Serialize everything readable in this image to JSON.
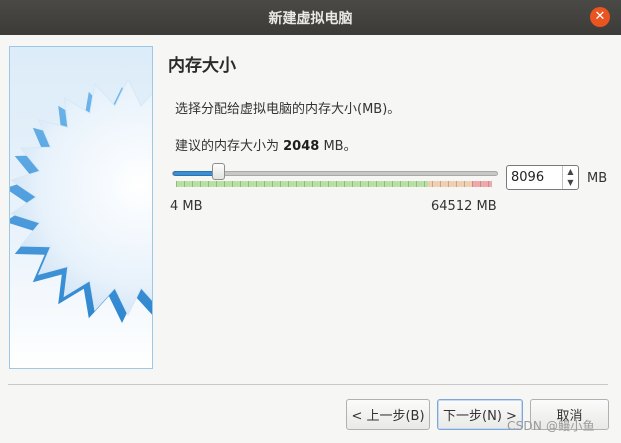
{
  "window": {
    "title": "新建虚拟电脑",
    "close_icon": "close-icon"
  },
  "page": {
    "heading": "内存大小",
    "description": "选择分配给虚拟电脑的内存大小(MB)。",
    "recommend_prefix": "建议的内存大小为 ",
    "recommend_value": "2048",
    "recommend_suffix": " MB。"
  },
  "memory": {
    "value": "8096",
    "unit": "MB",
    "min_label": "4 MB",
    "max_label": "64512 MB",
    "min": 4,
    "max": 64512,
    "current": 8096
  },
  "buttons": {
    "back": "< 上一步(B)",
    "next": "下一步(N) >",
    "cancel": "取消"
  },
  "watermark": "CSDN @鳗小鱼",
  "colors": {
    "title_bar": "#3c3b37",
    "close_button": "#e95420",
    "slider_fill": "#3b8fd6",
    "safe_zone": "#b7e2a4",
    "warn_zone": "#f1d0b2",
    "danger_zone": "#f0a8a8"
  }
}
